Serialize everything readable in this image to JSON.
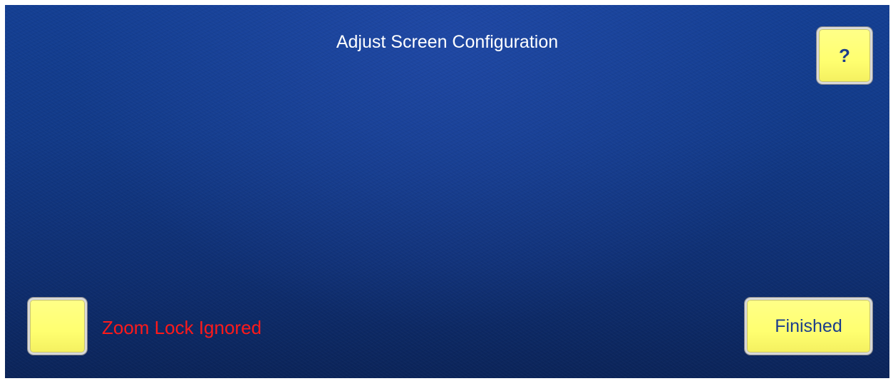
{
  "header": {
    "title": "Adjust Screen Configuration",
    "help_label": "?"
  },
  "footer": {
    "zoom_lock_label": "Zoom Lock Ignored",
    "zoom_lock_checked": false,
    "finished_label": "Finished"
  },
  "colors": {
    "background": "#123a88",
    "button_fill": "#ffff70",
    "button_text": "#1a3c8c",
    "zoom_lock_text": "#ff1a1a",
    "title_text": "#ffffff"
  }
}
